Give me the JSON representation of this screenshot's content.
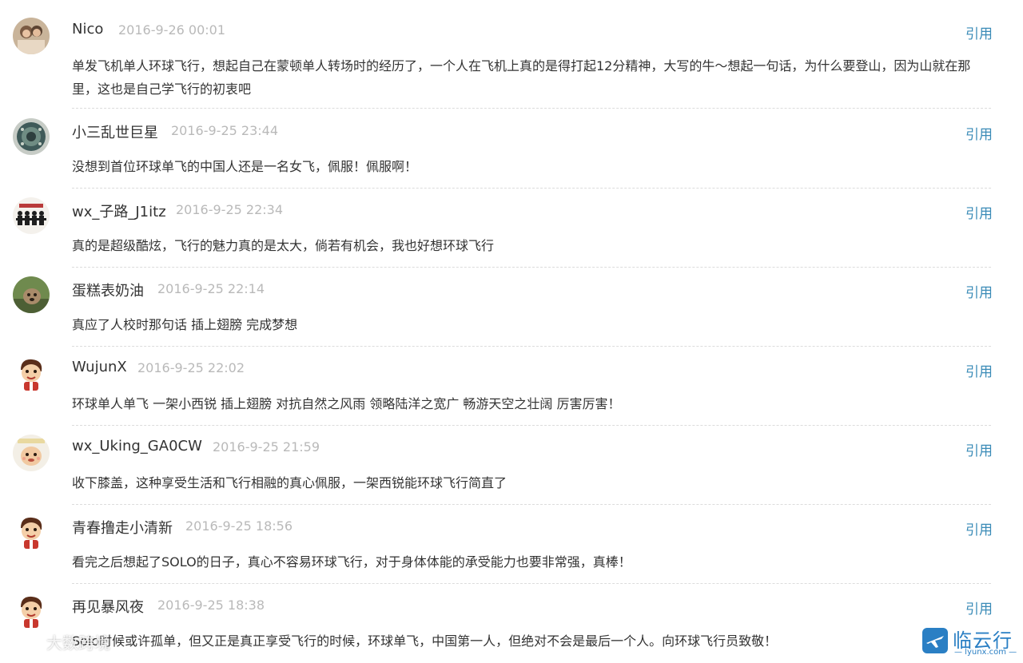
{
  "comments": [
    {
      "username": "Nico",
      "time": "2016-9-26 00:01",
      "action": "引用",
      "text": "单发飞机单人环球飞行，想起自己在蒙顿单人转场时的经历了，一个人在飞机上真的是得打起12分精神，大写的牛～想起一句话，为什么要登山，因为山就在那里，这也是自己学飞行的初衷吧"
    },
    {
      "username": "小三乱世巨星",
      "time": "2016-9-25 23:44",
      "action": "引用",
      "text": "没想到首位环球单飞的中国人还是一名女飞，佩服！佩服啊！"
    },
    {
      "username": "wx_子路_J1itz",
      "time": "2016-9-25 22:34",
      "action": "引用",
      "text": "真的是超级酷炫，飞行的魅力真的是太大，倘若有机会，我也好想环球飞行"
    },
    {
      "username": "蛋糕表奶油",
      "time": "2016-9-25 22:14",
      "action": "引用",
      "text": "真应了人校时那句话 插上翅膀 完成梦想"
    },
    {
      "username": "WujunX",
      "time": "2016-9-25 22:02",
      "action": "引用",
      "text": "环球单人单飞 一架小西锐 插上翅膀 对抗自然之风雨 领略陆洋之宽广 畅游天空之壮阔 厉害厉害！"
    },
    {
      "username": "wx_Uking_GA0CW",
      "time": "2016-9-25 21:59",
      "action": "引用",
      "text": "收下膝盖，这种享受生活和飞行相融的真心佩服，一架西锐能环球飞行简直了"
    },
    {
      "username": "青春撸走小清新",
      "time": "2016-9-25 18:56",
      "action": "引用",
      "text": "看完之后想起了SOLO的日子，真心不容易环球飞行，对于身体体能的承受能力也要非常强，真棒！"
    },
    {
      "username": "再见暴风夜",
      "time": "2016-9-25 18:38",
      "action": "引用",
      "text": "Solo时候或许孤单，但又正是真正享受飞行的时候，环球单飞，中国第一人，但绝对不会是最后一个人。向环球飞行员致敬！"
    }
  ],
  "avatars": [
    "photo-couple",
    "gem-crest",
    "paper-people",
    "photo-dog",
    "cartoon-boy",
    "cartoon-baby",
    "cartoon-boy",
    "cartoon-boy"
  ],
  "watermarks": {
    "left_text": "大数跨境",
    "right_name": "临云行",
    "right_url": "— lyunx.com —"
  },
  "colors": {
    "quote_link": "#3a8bb7",
    "timestamp": "#b9b9b9",
    "text": "#333333",
    "divider": "#dcdcdc"
  }
}
